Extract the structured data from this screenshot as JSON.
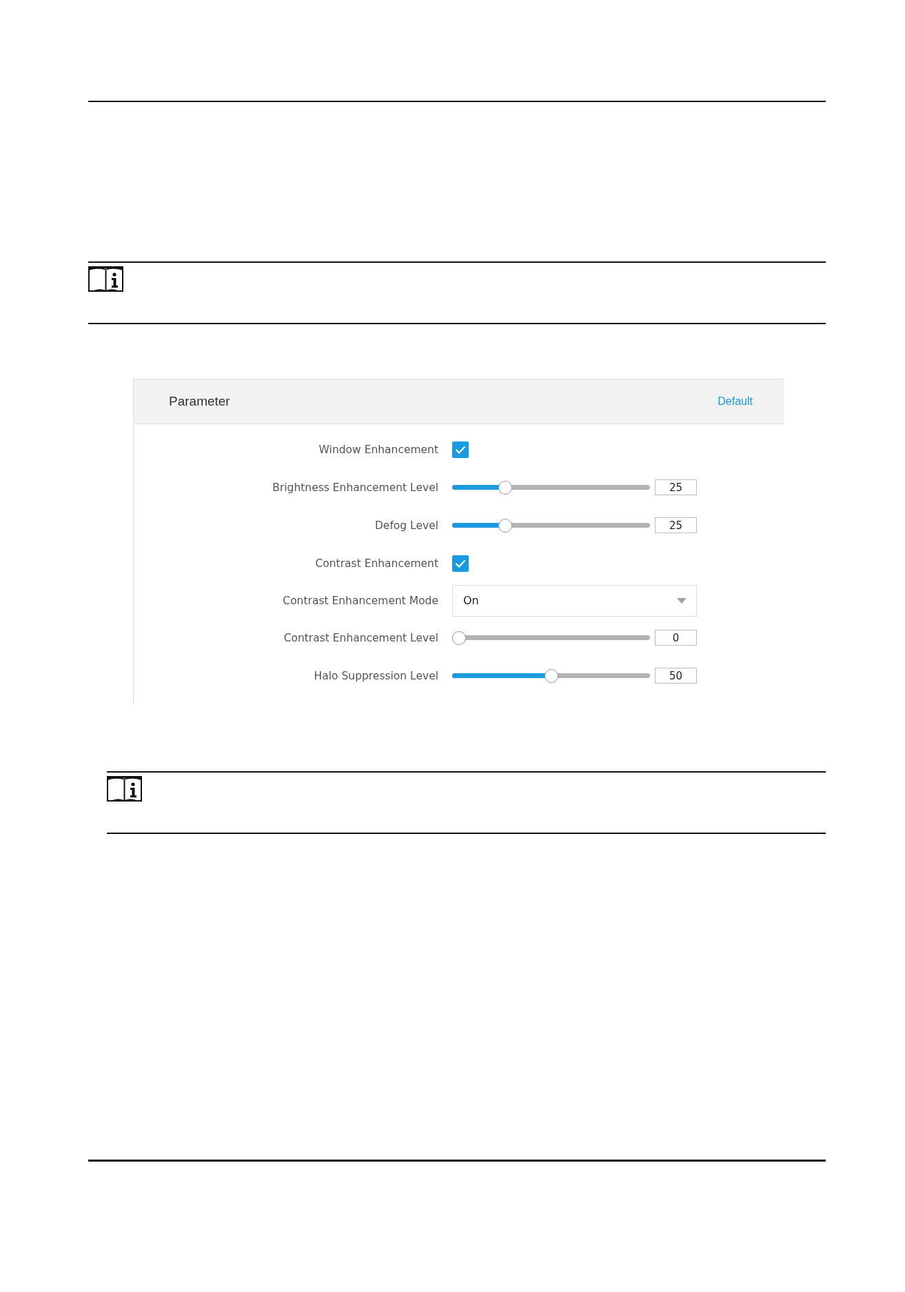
{
  "panel": {
    "title": "Parameter",
    "default_link": "Default",
    "rows": [
      {
        "kind": "checkbox",
        "label": "Window Enhancement",
        "checked": true
      },
      {
        "kind": "slider",
        "label": "Brightness Enhancement Level",
        "level": 0.25,
        "value": "25"
      },
      {
        "kind": "slider",
        "label": "Defog Level",
        "level": 0.25,
        "value": "25"
      },
      {
        "kind": "checkbox",
        "label": "Contrast Enhancement",
        "checked": true
      },
      {
        "kind": "select",
        "label": "Contrast Enhancement Mode",
        "value": "On"
      },
      {
        "kind": "slider",
        "label": "Contrast Enhancement Level",
        "level": 0,
        "value": "0"
      },
      {
        "kind": "slider",
        "label": "Halo Suppression Level",
        "level": 0.5,
        "value": "50"
      }
    ]
  }
}
